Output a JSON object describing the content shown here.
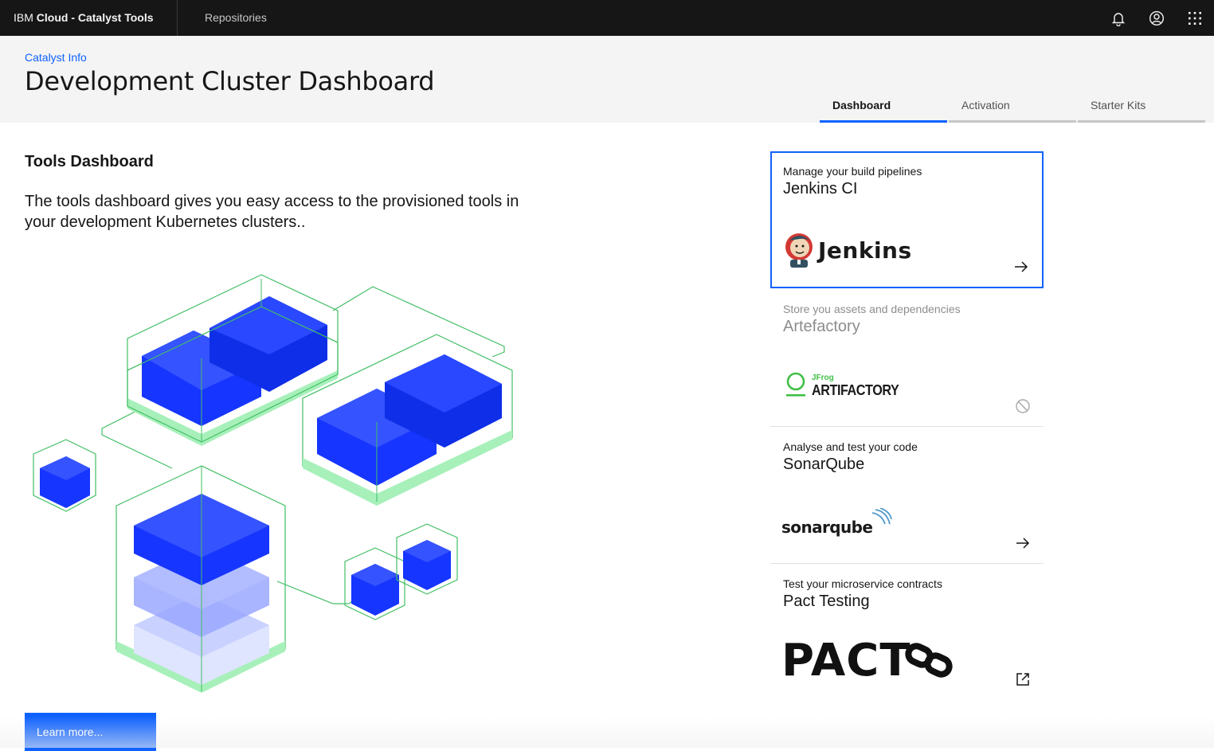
{
  "header": {
    "brand_prefix": "IBM",
    "brand_name": "Cloud - Catalyst Tools",
    "nav": [
      {
        "label": "Repositories"
      }
    ],
    "actions": [
      {
        "icon": "notification-icon"
      },
      {
        "icon": "user-avatar-icon"
      },
      {
        "icon": "app-switcher-icon"
      }
    ]
  },
  "page": {
    "breadcrumb": "Catalyst Info",
    "title": "Development Cluster Dashboard",
    "tabs": [
      {
        "label": "Dashboard",
        "active": true
      },
      {
        "label": "Activation",
        "active": false
      },
      {
        "label": "Starter Kits",
        "active": false
      }
    ]
  },
  "main": {
    "section_title": "Tools Dashboard",
    "intro": "The tools dashboard gives you easy access to the provisioned tools in your development Kubernetes clusters..",
    "learn_more": "Learn more..."
  },
  "tools": [
    {
      "description": "Manage your build pipelines",
      "name": "Jenkins CI",
      "logo_text": "Jenkins",
      "action_icon": "arrow-right-icon",
      "state": "selected"
    },
    {
      "description": "Store you assets and dependencies",
      "name": "Artefactory",
      "logo_text": "ARTIFACTORY",
      "logo_subtext": "JFrog",
      "action_icon": "disabled-icon",
      "state": "disabled"
    },
    {
      "description": "Analyse and test your code",
      "name": "SonarQube",
      "logo_text": "sonarqube",
      "action_icon": "arrow-right-icon",
      "state": "normal"
    },
    {
      "description": "Test your microservice contracts",
      "name": "Pact Testing",
      "logo_text": "PACT",
      "action_icon": "launch-icon",
      "state": "normal"
    }
  ],
  "colors": {
    "header_bg": "#161616",
    "accent": "#0f62fe",
    "cube_blue": "#0a2fff",
    "outline_green": "#42be65"
  }
}
